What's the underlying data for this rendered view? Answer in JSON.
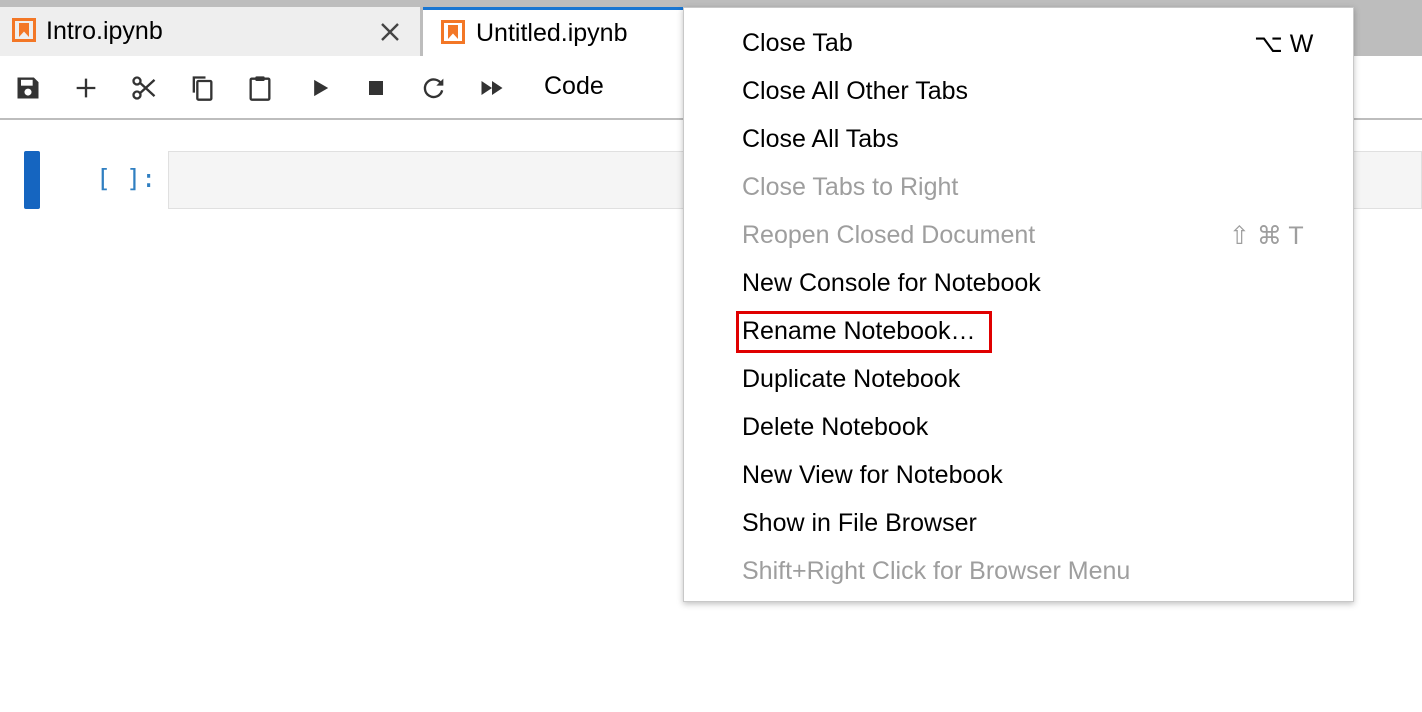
{
  "tabs": [
    {
      "label": "Intro.ipynb",
      "active": false
    },
    {
      "label": "Untitled.ipynb",
      "active": true
    }
  ],
  "toolbar": {
    "cell_type": "Code",
    "icons": [
      "save-icon",
      "plus-icon",
      "scissors-icon",
      "copy-icon",
      "paste-icon",
      "run-icon",
      "stop-icon",
      "restart-icon",
      "fast-forward-icon"
    ]
  },
  "cell": {
    "prompt": "[ ]:"
  },
  "menu": {
    "items": [
      {
        "label": "Close Tab",
        "shortcut": "⌥ W",
        "disabled": false
      },
      {
        "label": "Close All Other Tabs",
        "shortcut": "",
        "disabled": false
      },
      {
        "label": "Close All Tabs",
        "shortcut": "",
        "disabled": false
      },
      {
        "label": "Close Tabs to Right",
        "shortcut": "",
        "disabled": true
      },
      {
        "label": "Reopen Closed Document",
        "shortcut": "⇧ ⌘ T",
        "disabled": true
      },
      {
        "label": "New Console for Notebook",
        "shortcut": "",
        "disabled": false
      },
      {
        "label": "Rename Notebook…",
        "shortcut": "",
        "disabled": false,
        "highlighted": true
      },
      {
        "label": "Duplicate Notebook",
        "shortcut": "",
        "disabled": false
      },
      {
        "label": "Delete Notebook",
        "shortcut": "",
        "disabled": false
      },
      {
        "label": "New View for Notebook",
        "shortcut": "",
        "disabled": false
      },
      {
        "label": "Show in File Browser",
        "shortcut": "",
        "disabled": false
      },
      {
        "label": "Shift+Right Click for Browser Menu",
        "shortcut": "",
        "disabled": true
      }
    ]
  },
  "colors": {
    "accent": "#1976d2",
    "notebook_icon": "#f37726",
    "highlight": "#e00000",
    "disabled_text": "#9e9e9e",
    "prompt": "#307fc1"
  }
}
